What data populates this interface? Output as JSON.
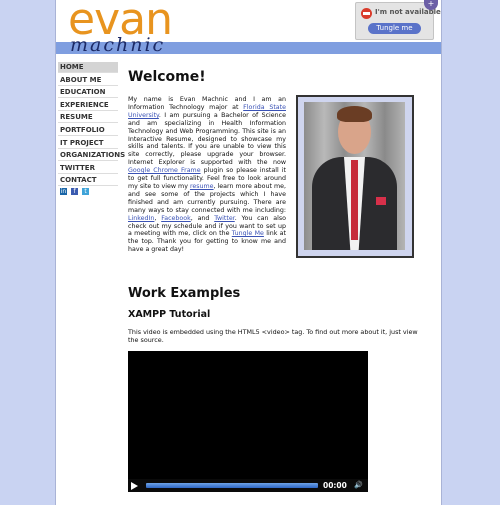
{
  "header": {
    "logo_main": "evan",
    "logo_sub": "machnic",
    "status_text": "I'm not available",
    "status_button": "Tungle me",
    "corner_tab": "+"
  },
  "nav": {
    "items": [
      "HOME",
      "ABOUT ME",
      "EDUCATION",
      "EXPERIENCE",
      "RESUME",
      "PORTFOLIO",
      "IT PROJECT",
      "ORGANIZATIONS",
      "TWITTER",
      "CONTACT"
    ],
    "social": [
      "in",
      "f",
      "rss"
    ]
  },
  "welcome": {
    "title": "Welcome!",
    "bio_intro": "My name is Evan Machnic and I am an Information Technology major at ",
    "bio_link_fsu": "Florida State University",
    "bio_mid1": ". I am pursuing a Bachelor of Science and am specializing in Health Information Technology and Web Programming. This site is an Interactive Resume, designed to showcase my skills and talents. If you are unable to view this site correctly, please upgrade your browser. Internet Explorer is supported with the now ",
    "bio_link_gcf": "Google Chrome Frame",
    "bio_mid2": " plugin so please install it to get full functionality. Feel free to look around my site to view my ",
    "bio_link_resume": "resume",
    "bio_mid3": ", learn more about me, and see some of the projects which I have finished and am currently pursuing. There are many ways to stay connected with me including: ",
    "bio_link_linkedin": "LinkedIn",
    "bio_sep": ", ",
    "bio_link_facebook": "Facebook",
    "bio_and": ", and ",
    "bio_link_twitter": "Twitter",
    "bio_mid4": ". You can also check out my schedule and if you want to set up a meeting with me, click on the ",
    "bio_link_tungle": "Tungle Me",
    "bio_end": " link at the top. Thank you for getting to know me and have a great day!"
  },
  "work": {
    "title": "Work Examples",
    "subtitle": "XAMPP Tutorial",
    "description": "This video is embedded using the HTML5 <video> tag. To find out more about it, just view the source.",
    "video_time": "00:00"
  }
}
